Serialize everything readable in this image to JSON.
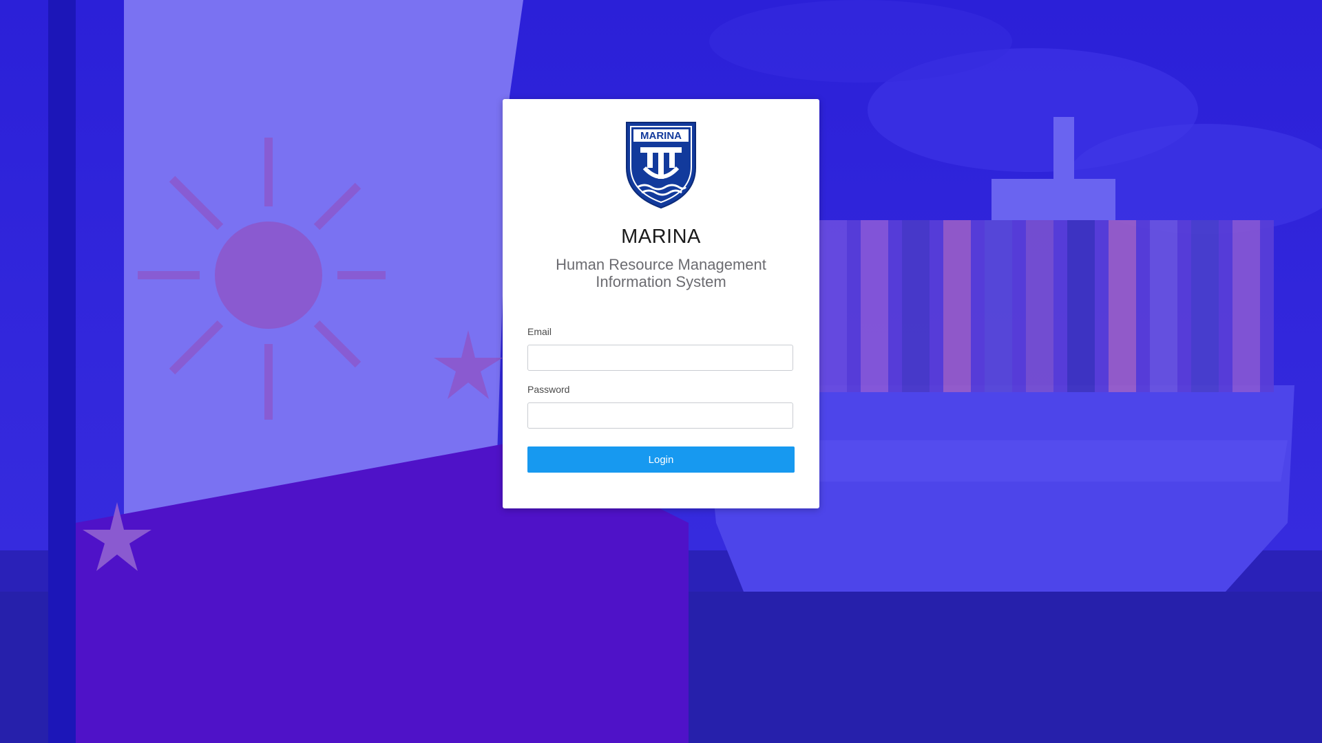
{
  "login": {
    "title": "MARINA",
    "subtitle": "Human Resource Management Information System",
    "logo_text": "MARINA",
    "email_label": "Email",
    "email_value": "",
    "password_label": "Password",
    "password_value": "",
    "login_button": "Login"
  },
  "colors": {
    "overlay": "#2c22d6",
    "button": "#1799f0",
    "logo": "#123a9c"
  }
}
